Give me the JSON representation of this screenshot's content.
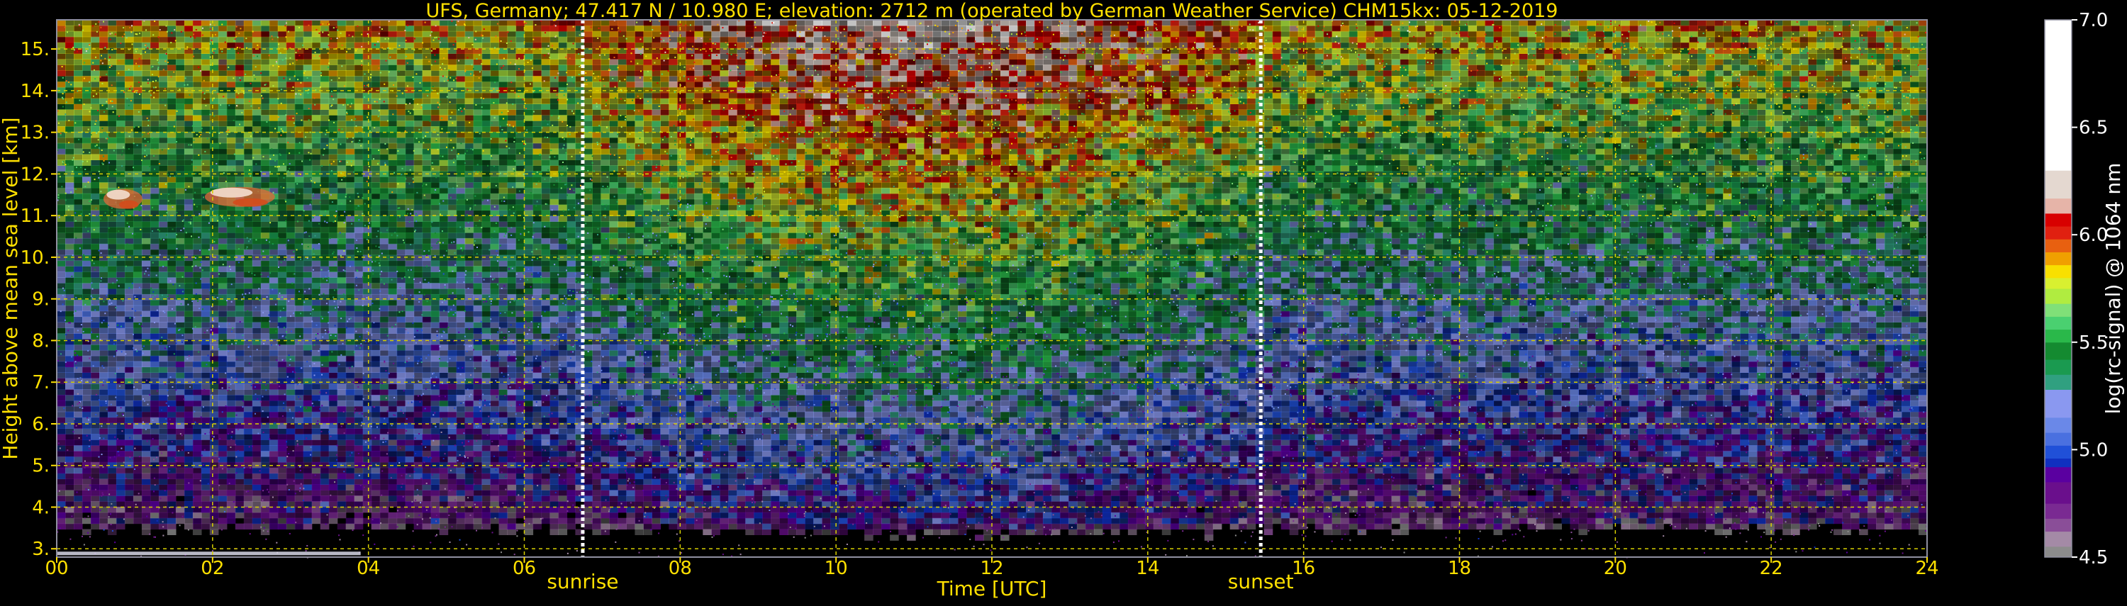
{
  "chart_data": {
    "type": "heatmap",
    "title": "UFS, Germany; 47.417 N / 10.980 E; elevation: 2712 m  (operated by German Weather Service)    CHM15kx: 05-12-2019",
    "xlabel": "Time [UTC]",
    "ylabel": "Height above mean sea level [km]",
    "xlim": [
      0,
      24
    ],
    "ylim": [
      2.8,
      15.7
    ],
    "x_ticks": [
      "00",
      "02",
      "04",
      "06",
      "08",
      "10",
      "12",
      "14",
      "16",
      "18",
      "20",
      "22",
      "24"
    ],
    "y_ticks": [
      "3.",
      "4.",
      "5.",
      "6.",
      "7.",
      "8.",
      "9.",
      "10.",
      "11.",
      "12.",
      "13.",
      "14.",
      "15."
    ],
    "grid": true,
    "events": [
      {
        "label": "sunrise",
        "time_utc": 6.75
      },
      {
        "label": "sunset",
        "time_utc": 15.45
      }
    ],
    "features": [
      {
        "kind": "cloud-layer",
        "time_start_utc": 0.6,
        "time_end_utc": 1.1,
        "height_km": 11.4
      },
      {
        "kind": "cloud-layer",
        "time_start_utc": 1.9,
        "time_end_utc": 2.8,
        "height_km": 11.45
      },
      {
        "kind": "near-ground-layer",
        "time_start_utc": 0.0,
        "time_end_utc": 3.9,
        "height_km": 2.88
      }
    ],
    "colorbar": {
      "label": "log(rc-signal) @ 1064 nm",
      "range": [
        4.5,
        7.0
      ],
      "ticks": [
        "4.5",
        "5.0",
        "5.5",
        "6.0",
        "6.5",
        "7.0"
      ],
      "colors": [
        {
          "from": 4.5,
          "to": 4.55,
          "color": "#8c8c8c"
        },
        {
          "from": 4.55,
          "to": 4.62,
          "color": "#a48aa6"
        },
        {
          "from": 4.62,
          "to": 4.68,
          "color": "#8a4e98"
        },
        {
          "from": 4.68,
          "to": 4.75,
          "color": "#7a2a92"
        },
        {
          "from": 4.75,
          "to": 4.85,
          "color": "#6a0f8c"
        },
        {
          "from": 4.85,
          "to": 4.92,
          "color": "#5a00a0"
        },
        {
          "from": 4.92,
          "to": 4.96,
          "color": "#1030c0"
        },
        {
          "from": 4.96,
          "to": 5.02,
          "color": "#2050d8"
        },
        {
          "from": 5.02,
          "to": 5.08,
          "color": "#4a70e0"
        },
        {
          "from": 5.08,
          "to": 5.15,
          "color": "#6a88e8"
        },
        {
          "from": 5.15,
          "to": 5.28,
          "color": "#8a98f0"
        },
        {
          "from": 5.28,
          "to": 5.35,
          "color": "#30a080"
        },
        {
          "from": 5.35,
          "to": 5.42,
          "color": "#1a9a50"
        },
        {
          "from": 5.42,
          "to": 5.5,
          "color": "#148a30"
        },
        {
          "from": 5.5,
          "to": 5.56,
          "color": "#2ab84a"
        },
        {
          "from": 5.56,
          "to": 5.62,
          "color": "#4ad070"
        },
        {
          "from": 5.62,
          "to": 5.68,
          "color": "#80e078"
        },
        {
          "from": 5.68,
          "to": 5.75,
          "color": "#b0ec40"
        },
        {
          "from": 5.75,
          "to": 5.8,
          "color": "#d8f030"
        },
        {
          "from": 5.8,
          "to": 5.86,
          "color": "#f8e000"
        },
        {
          "from": 5.86,
          "to": 5.92,
          "color": "#f0a000"
        },
        {
          "from": 5.92,
          "to": 5.98,
          "color": "#e86010"
        },
        {
          "from": 5.98,
          "to": 6.04,
          "color": "#e02010"
        },
        {
          "from": 6.04,
          "to": 6.1,
          "color": "#d80000"
        },
        {
          "from": 6.1,
          "to": 6.17,
          "color": "#e6b4a8"
        },
        {
          "from": 6.17,
          "to": 6.3,
          "color": "#e4d8d0"
        },
        {
          "from": 6.3,
          "to": 7.0,
          "color": "#ffffff"
        }
      ]
    },
    "colors": {
      "background": "#000000",
      "text": "#ffe000",
      "grid": "#d8d000",
      "colorbar_text": "#ffffff",
      "event_line": "#ffffff",
      "frame": "#9090a0"
    }
  }
}
